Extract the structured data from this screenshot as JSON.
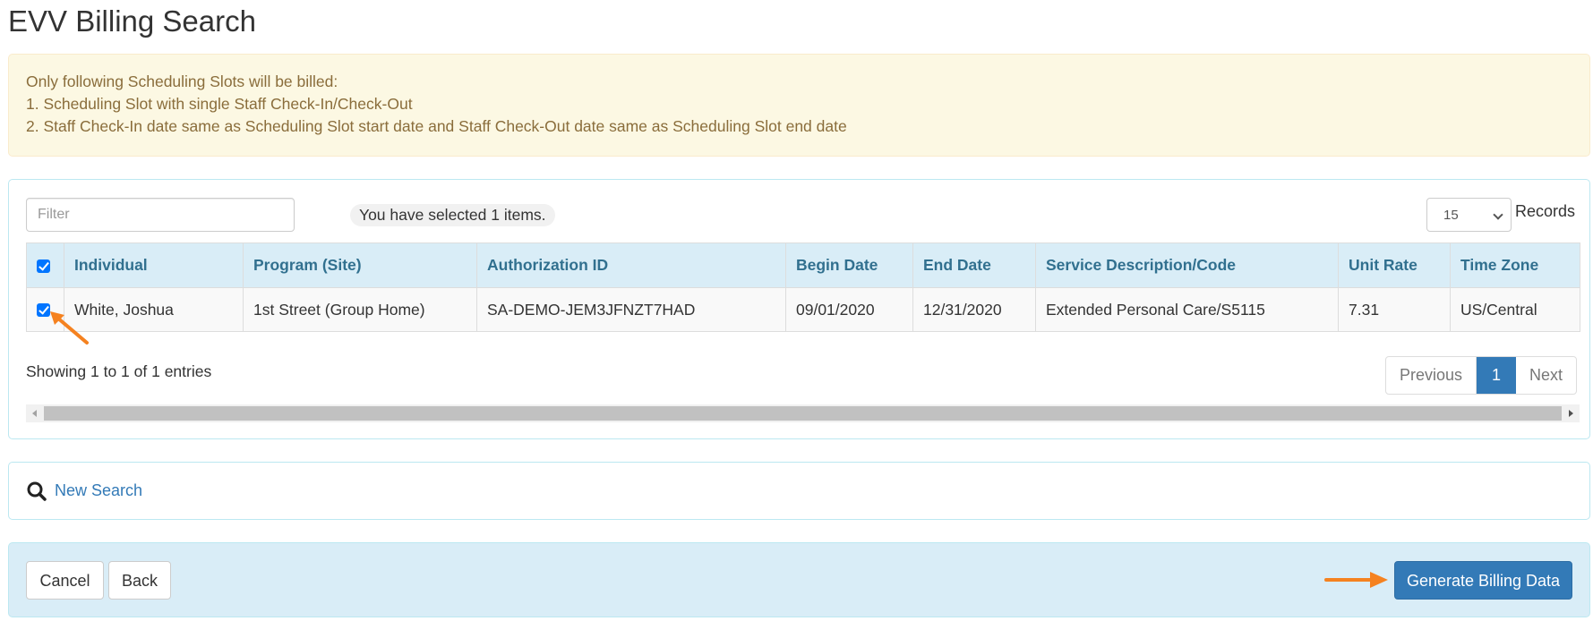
{
  "page": {
    "title": "EVV Billing Search"
  },
  "alert": {
    "lines": [
      "Only following Scheduling Slots will be billed:",
      "1. Scheduling Slot with single Staff Check-In/Check-Out",
      "2. Staff Check-In date same as Scheduling Slot start date and Staff Check-Out date same as Scheduling Slot end date"
    ]
  },
  "table_panel": {
    "filter": {
      "placeholder": "Filter",
      "value": ""
    },
    "selected_info": "You have selected 1 items.",
    "records_select": {
      "value": "15",
      "label": "Records"
    },
    "columns": [
      "Individual",
      "Program (Site)",
      "Authorization ID",
      "Begin Date",
      "End Date",
      "Service Description/Code",
      "Unit Rate",
      "Time Zone"
    ],
    "header_checkbox_checked": true,
    "rows": [
      {
        "checked": true,
        "cells": [
          "White, Joshua",
          "1st Street (Group Home)",
          "SA-DEMO-JEM3JFNZT7HAD",
          "09/01/2020",
          "12/31/2020",
          "Extended Personal Care/S5115",
          "7.31",
          "US/Central"
        ]
      }
    ],
    "showing_info": "Showing 1 to 1 of 1 entries",
    "pagination": {
      "previous": "Previous",
      "current": "1",
      "next": "Next"
    }
  },
  "search_panel": {
    "icon": "search-icon",
    "link_label": "New Search"
  },
  "footer": {
    "cancel_label": "Cancel",
    "back_label": "Back",
    "generate_label": "Generate Billing Data"
  },
  "colors": {
    "primary": "#337ab7",
    "annotation_arrow": "#f58220",
    "alert_bg": "#fcf8e3",
    "alert_text": "#8a6d3b",
    "info_bg": "#d9edf7",
    "header_text": "#31708f"
  }
}
